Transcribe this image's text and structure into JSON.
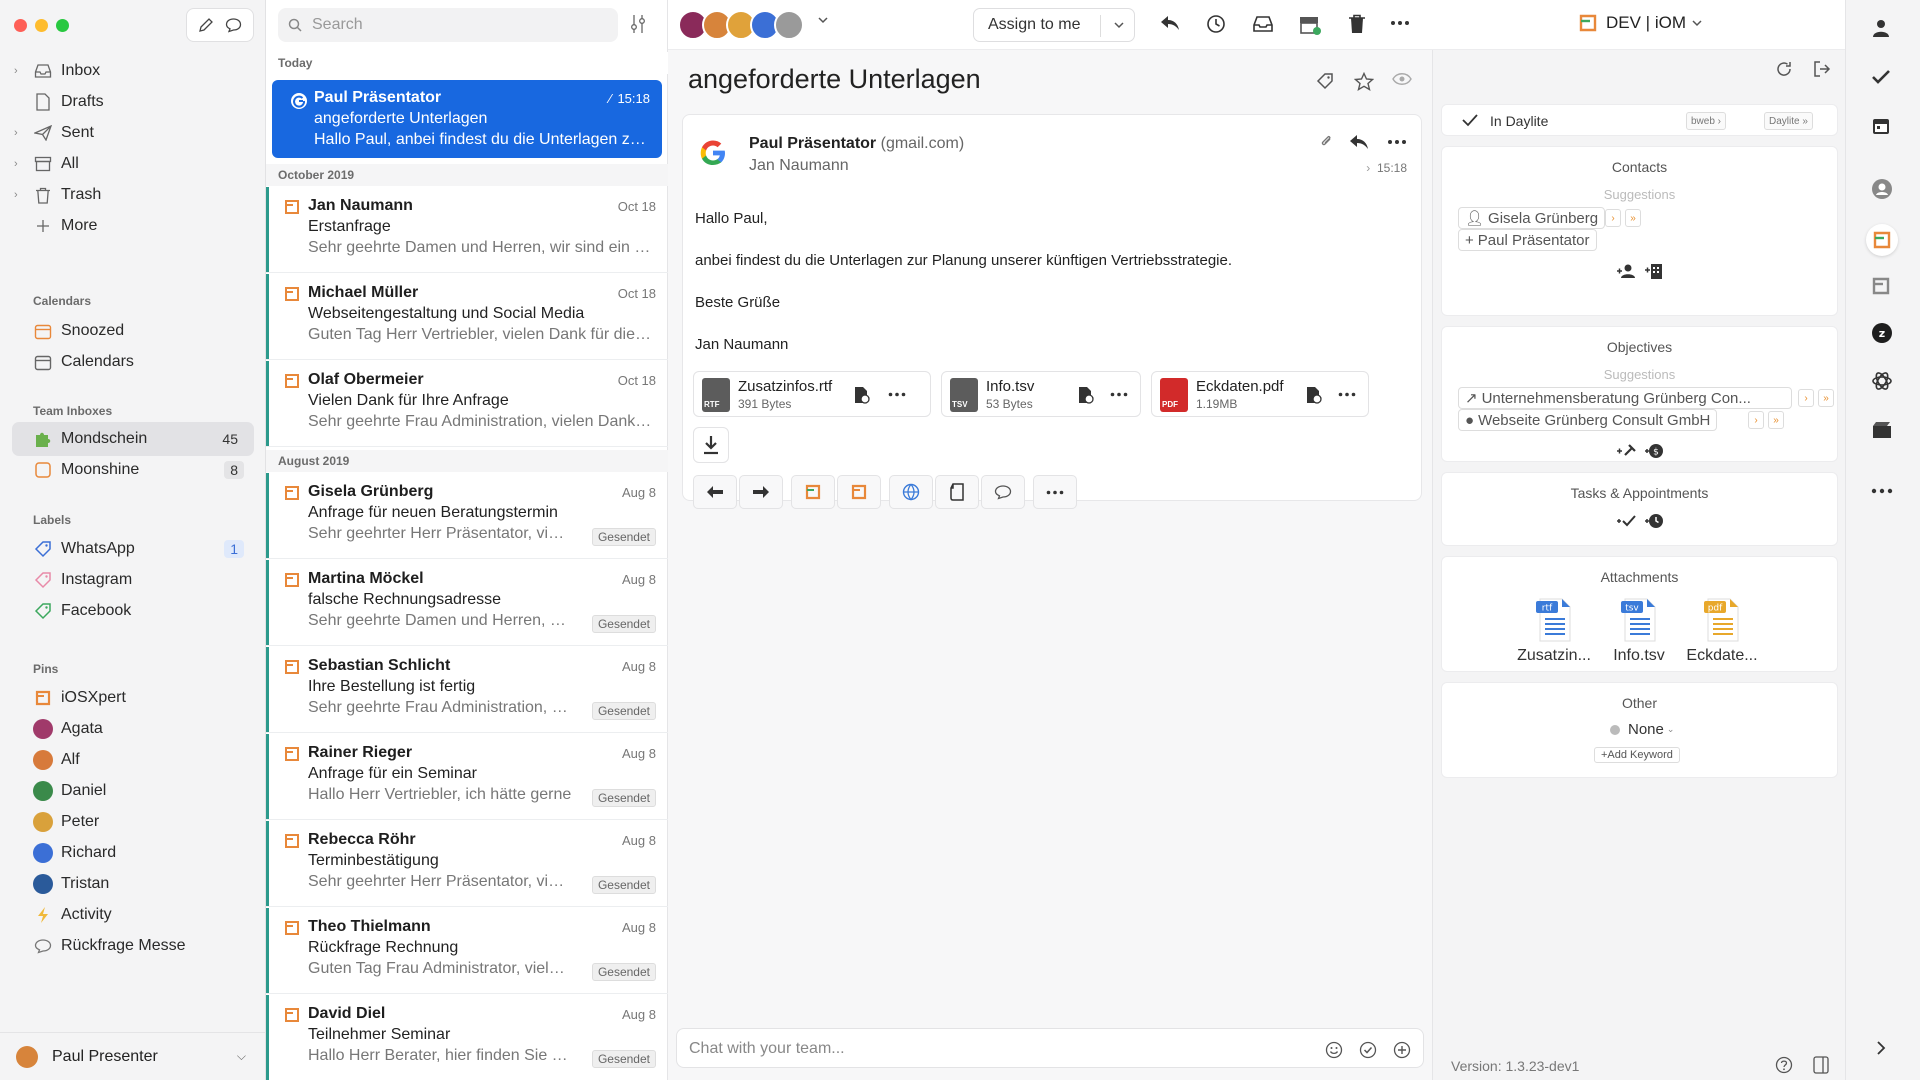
{
  "sidebar": {
    "mailboxes": [
      {
        "label": "Inbox",
        "icon": "inbox-icon",
        "expandable": true
      },
      {
        "label": "Drafts",
        "icon": "draft-icon",
        "expandable": false
      },
      {
        "label": "Sent",
        "icon": "send-icon",
        "expandable": true
      },
      {
        "label": "All",
        "icon": "archive-icon",
        "expandable": true
      },
      {
        "label": "Trash",
        "icon": "trash-icon",
        "expandable": true
      },
      {
        "label": "More",
        "icon": "plus-icon",
        "expandable": false
      }
    ],
    "calendars_header": "Calendars",
    "calendars": [
      {
        "label": "Snoozed",
        "icon": "calendar-icon",
        "color": "#e8883a"
      },
      {
        "label": "Calendars",
        "icon": "calendar-icon",
        "color": "#666666"
      }
    ],
    "team_header": "Team Inboxes",
    "team": [
      {
        "label": "Mondschein",
        "count": "45",
        "icon": "puzzle-icon",
        "color": "#6ab04c"
      },
      {
        "label": "Moonshine",
        "count": "8",
        "icon": "square-icon",
        "color": "#e8883a"
      }
    ],
    "labels_header": "Labels",
    "labels": [
      {
        "label": "WhatsApp",
        "count": "1",
        "color": "#3b6fd6"
      },
      {
        "label": "Instagram",
        "count": "",
        "color": "#e88aa8"
      },
      {
        "label": "Facebook",
        "count": "",
        "color": "#3ca85e"
      }
    ],
    "pins_header": "Pins",
    "pins": [
      {
        "label": "iOSXpert",
        "icon": "daylite-icon"
      },
      {
        "label": "Agata",
        "icon": "avatar",
        "color": "#a03a6a"
      },
      {
        "label": "Alf",
        "icon": "avatar",
        "color": "#d77a3b"
      },
      {
        "label": "Daniel",
        "icon": "avatar",
        "color": "#3a8a4a"
      },
      {
        "label": "Peter",
        "icon": "avatar",
        "color": "#d9a13b"
      },
      {
        "label": "Richard",
        "icon": "avatar",
        "color": "#3b6fd6"
      },
      {
        "label": "Tristan",
        "icon": "avatar",
        "color": "#2a5a9a"
      },
      {
        "label": "Activity",
        "icon": "bolt-icon",
        "color": "#f0b93a"
      },
      {
        "label": "Rückfrage Messe",
        "icon": "chat-icon",
        "color": "#777777"
      }
    ],
    "user": "Paul Presenter"
  },
  "list": {
    "search_placeholder": "Search",
    "groups": {
      "today": "Today",
      "oct": "October 2019",
      "aug": "August 2019"
    },
    "selected": {
      "from": "Paul Präsentator",
      "time": "15:18",
      "subject": "angeforderte Unterlagen",
      "preview": "Hallo Paul, anbei findest du die Unterlagen zur Planung unserer künftigen Vertriebsstrategie."
    },
    "mails": [
      {
        "from": "Jan Naumann",
        "date": "Oct 18",
        "subject": "Erstanfrage",
        "preview": "Sehr geehrte Damen und Herren, wir sind ein mittelständisches Unternehmen",
        "tag": ""
      },
      {
        "from": "Michael Müller",
        "date": "Oct 18",
        "subject": "Webseitengestaltung und Social Media",
        "preview": "Guten Tag Herr Vertriebler, vielen Dank für die schnelle Rückmeldung",
        "tag": ""
      },
      {
        "from": "Olaf Obermeier",
        "date": "Oct 18",
        "subject": "Vielen Dank für Ihre Anfrage",
        "preview": "Sehr geehrte Frau Administration, vielen Dank für Ihre Anfrage",
        "tag": ""
      },
      {
        "from": "Gisela Grünberg",
        "date": "Aug 8",
        "subject": "Anfrage für neuen Beratungstermin",
        "preview": "Sehr geehrter Herr Präsentator, vielen Dank",
        "tag": "Gesendet"
      },
      {
        "from": "Martina Möckel",
        "date": "Aug 8",
        "subject": "falsche Rechnungsadresse",
        "preview": "Sehr geehrte Damen und Herren, die Rechnung",
        "tag": "Gesendet"
      },
      {
        "from": "Sebastian Schlicht",
        "date": "Aug 8",
        "subject": "Ihre Bestellung ist fertig",
        "preview": "Sehr geehrte Frau Administration, vielen Dank",
        "tag": "Gesendet"
      },
      {
        "from": "Rainer Rieger",
        "date": "Aug 8",
        "subject": "Anfrage für ein Seminar",
        "preview": "Hallo Herr Vertriebler, ich hätte gerne",
        "tag": "Gesendet"
      },
      {
        "from": "Rebecca Röhr",
        "date": "Aug 8",
        "subject": "Terminbestätigung",
        "preview": "Sehr geehrter Herr Präsentator, vielen Dank",
        "tag": "Gesendet"
      },
      {
        "from": "Theo Thielmann",
        "date": "Aug 8",
        "subject": "Rückfrage Rechnung",
        "preview": "Guten Tag Frau Administrator, vielen Dank",
        "tag": "Gesendet"
      },
      {
        "from": "David Diel",
        "date": "Aug 8",
        "subject": "Teilnehmer Seminar",
        "preview": "Hallo Herr Berater, hier finden Sie alle",
        "tag": "Gesendet"
      }
    ]
  },
  "toolbar": {
    "assign_label": "Assign to me",
    "account": "DEV | iOM",
    "avatar_colors": [
      "#8a2a5a",
      "#d7843b",
      "#e0a23a",
      "#3b6fd6",
      "#9a9a9a"
    ]
  },
  "reader": {
    "title": "angeforderte Unterlagen",
    "from": "Paul Präsentator",
    "domain": "(gmail.com)",
    "to": "Jan Naumann",
    "time": "15:18",
    "body": [
      "Hallo Paul,",
      "anbei findest du die Unterlagen zur Planung unserer künftigen Vertriebsstrategie.",
      "Beste Grüße",
      "Jan Naumann"
    ],
    "attachments": [
      {
        "name": "Zusatzinfos.rtf",
        "size": "391 Bytes",
        "ext": "RTF",
        "color": "#5c5c5c"
      },
      {
        "name": "Info.tsv",
        "size": "53 Bytes",
        "ext": "TSV",
        "color": "#5c5c5c"
      },
      {
        "name": "Eckdaten.pdf",
        "size": "1.19MB",
        "ext": "PDF",
        "color": "#d22a2a"
      }
    ],
    "chat_placeholder": "Chat with your team..."
  },
  "panel": {
    "in_daylite": "In Daylite",
    "source_chips": [
      "bweb",
      "Daylite"
    ],
    "contacts_header": "Contacts",
    "suggestions_label": "Suggestions",
    "contact_suggestions": [
      "Gisela Grünberg",
      "Paul Präsentator"
    ],
    "objectives_header": "Objectives",
    "objective_suggestions": [
      "Unternehmensberatung Grünberg Con...",
      "Webseite Grünberg Consult GmbH"
    ],
    "tasks_header": "Tasks & Appointments",
    "attachments_header": "Attachments",
    "attachment_files": [
      {
        "name": "Zusatzin...",
        "ext": "rtf",
        "color": "#3b7bd9"
      },
      {
        "name": "Info.tsv",
        "ext": "tsv",
        "color": "#3b7bd9"
      },
      {
        "name": "Eckdate...",
        "ext": "pdf",
        "color": "#e8a82b"
      }
    ],
    "other_header": "Other",
    "other_value": "None",
    "add_keyword": "+Add Keyword",
    "version": "Version: 1.3.23-dev1"
  },
  "colors": {
    "accent": "#1868e0",
    "teal": "#2c9a8c",
    "orange": "#e8883a"
  }
}
